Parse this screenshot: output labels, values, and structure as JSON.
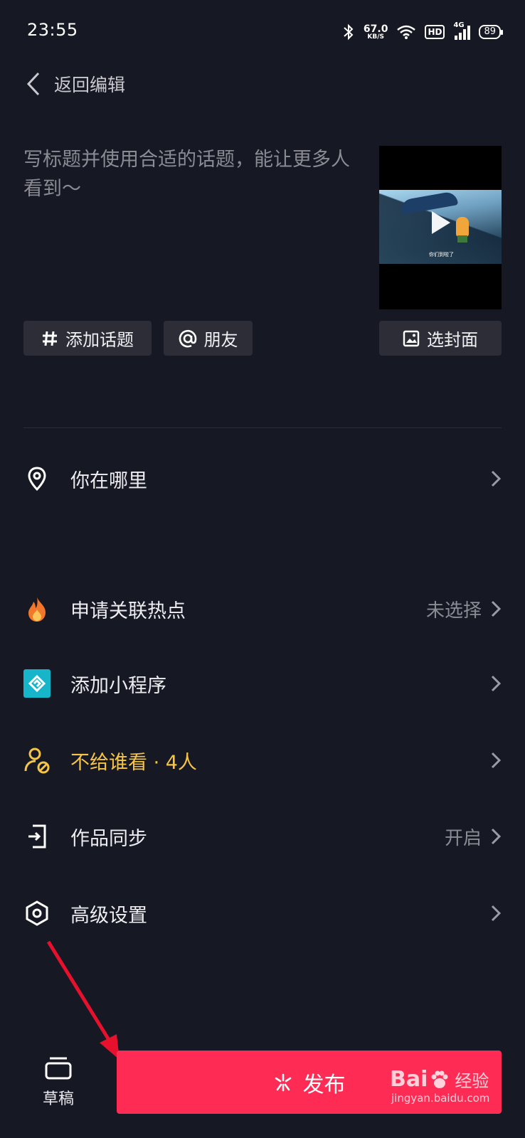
{
  "status_bar": {
    "time": "23:55",
    "speed_value": "67.0",
    "speed_unit": "KB/S",
    "hd_label": "HD",
    "network": "4G",
    "battery": "89",
    "icons": [
      "bluetooth-icon",
      "wifi-icon",
      "signal-icon"
    ]
  },
  "header": {
    "back_label": "返回编辑"
  },
  "caption": {
    "placeholder": "写标题并使用合适的话题，能让更多人看到～"
  },
  "video": {
    "subtitle_text": "你们到啦了"
  },
  "chips": {
    "topic": "添加话题",
    "friend": "朋友",
    "cover": "选封面"
  },
  "settings": [
    {
      "icon": "location-pin-icon",
      "label": "你在哪里",
      "value": ""
    },
    {
      "icon": "flame-icon",
      "label": "申请关联热点",
      "value": "未选择"
    },
    {
      "icon": "mini-program-icon",
      "label": "添加小程序",
      "value": ""
    },
    {
      "icon": "user-block-icon",
      "label": "不给谁看 · 4人",
      "value": ""
    },
    {
      "icon": "sync-icon",
      "label": "作品同步",
      "value": "开启"
    },
    {
      "icon": "settings-hexagon-icon",
      "label": "高级设置",
      "value": ""
    }
  ],
  "bottom": {
    "drafts_label": "草稿",
    "publish_label": "发布"
  },
  "watermark": {
    "brand_left": "Bai",
    "brand_right": "经验",
    "url": "jingyan.baidu.com"
  },
  "colors": {
    "background": "#161823",
    "publish": "#fe2c55",
    "warning": "#f6c544",
    "mini_program": "#16b5c9",
    "annotation_arrow": "#e8112d"
  }
}
